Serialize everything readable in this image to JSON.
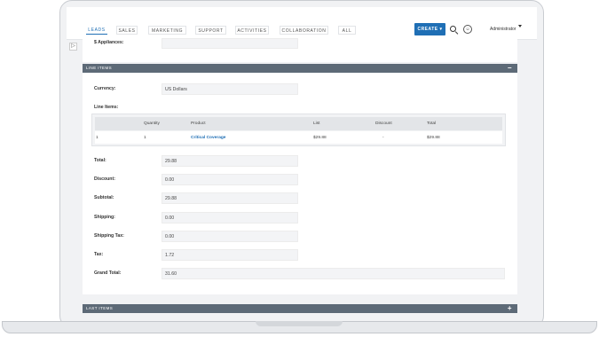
{
  "nav": {
    "tabs": [
      {
        "label": "LEADS",
        "active": true
      },
      {
        "label": "SALES",
        "active": false
      },
      {
        "label": "MARKETING",
        "active": false
      },
      {
        "label": "SUPPORT",
        "active": false
      },
      {
        "label": "ACTIVITIES",
        "active": false
      },
      {
        "label": "COLLABORATION",
        "active": false
      },
      {
        "label": "ALL",
        "active": false
      }
    ],
    "create_label": "CREATE",
    "user_label": "Administrator",
    "search_icon": "search-icon",
    "accent_color": "#1f6fb5"
  },
  "top_field": {
    "label": "$ Appliances:",
    "value": ""
  },
  "line_items_panel": {
    "title": "LINE ITEMS",
    "collapse_symbol": "−",
    "currency_label": "Currency:",
    "currency_value": "US Dollars",
    "items_label": "Line Items:",
    "columns": [
      "",
      "Quantity",
      "Product",
      "List",
      "Discount",
      "Total"
    ],
    "rows": [
      {
        "num": "1",
        "quantity": "1",
        "product": "Critical Coverage",
        "list": "$29.88",
        "discount": "-",
        "total": "$29.88"
      }
    ],
    "totals": [
      {
        "label": "Total:",
        "value": "29.88"
      },
      {
        "label": "Discount:",
        "value": "0.00"
      },
      {
        "label": "Subtotal:",
        "value": "29.88"
      },
      {
        "label": "Shipping:",
        "value": "0.00"
      },
      {
        "label": "Shipping Tax:",
        "value": "0.00"
      },
      {
        "label": "Tax:",
        "value": "1.72"
      },
      {
        "label": "Grand Total:",
        "value": "31.60"
      }
    ]
  },
  "next_panel": {
    "title": "LAST ITEMS",
    "collapse_symbol": "+"
  }
}
